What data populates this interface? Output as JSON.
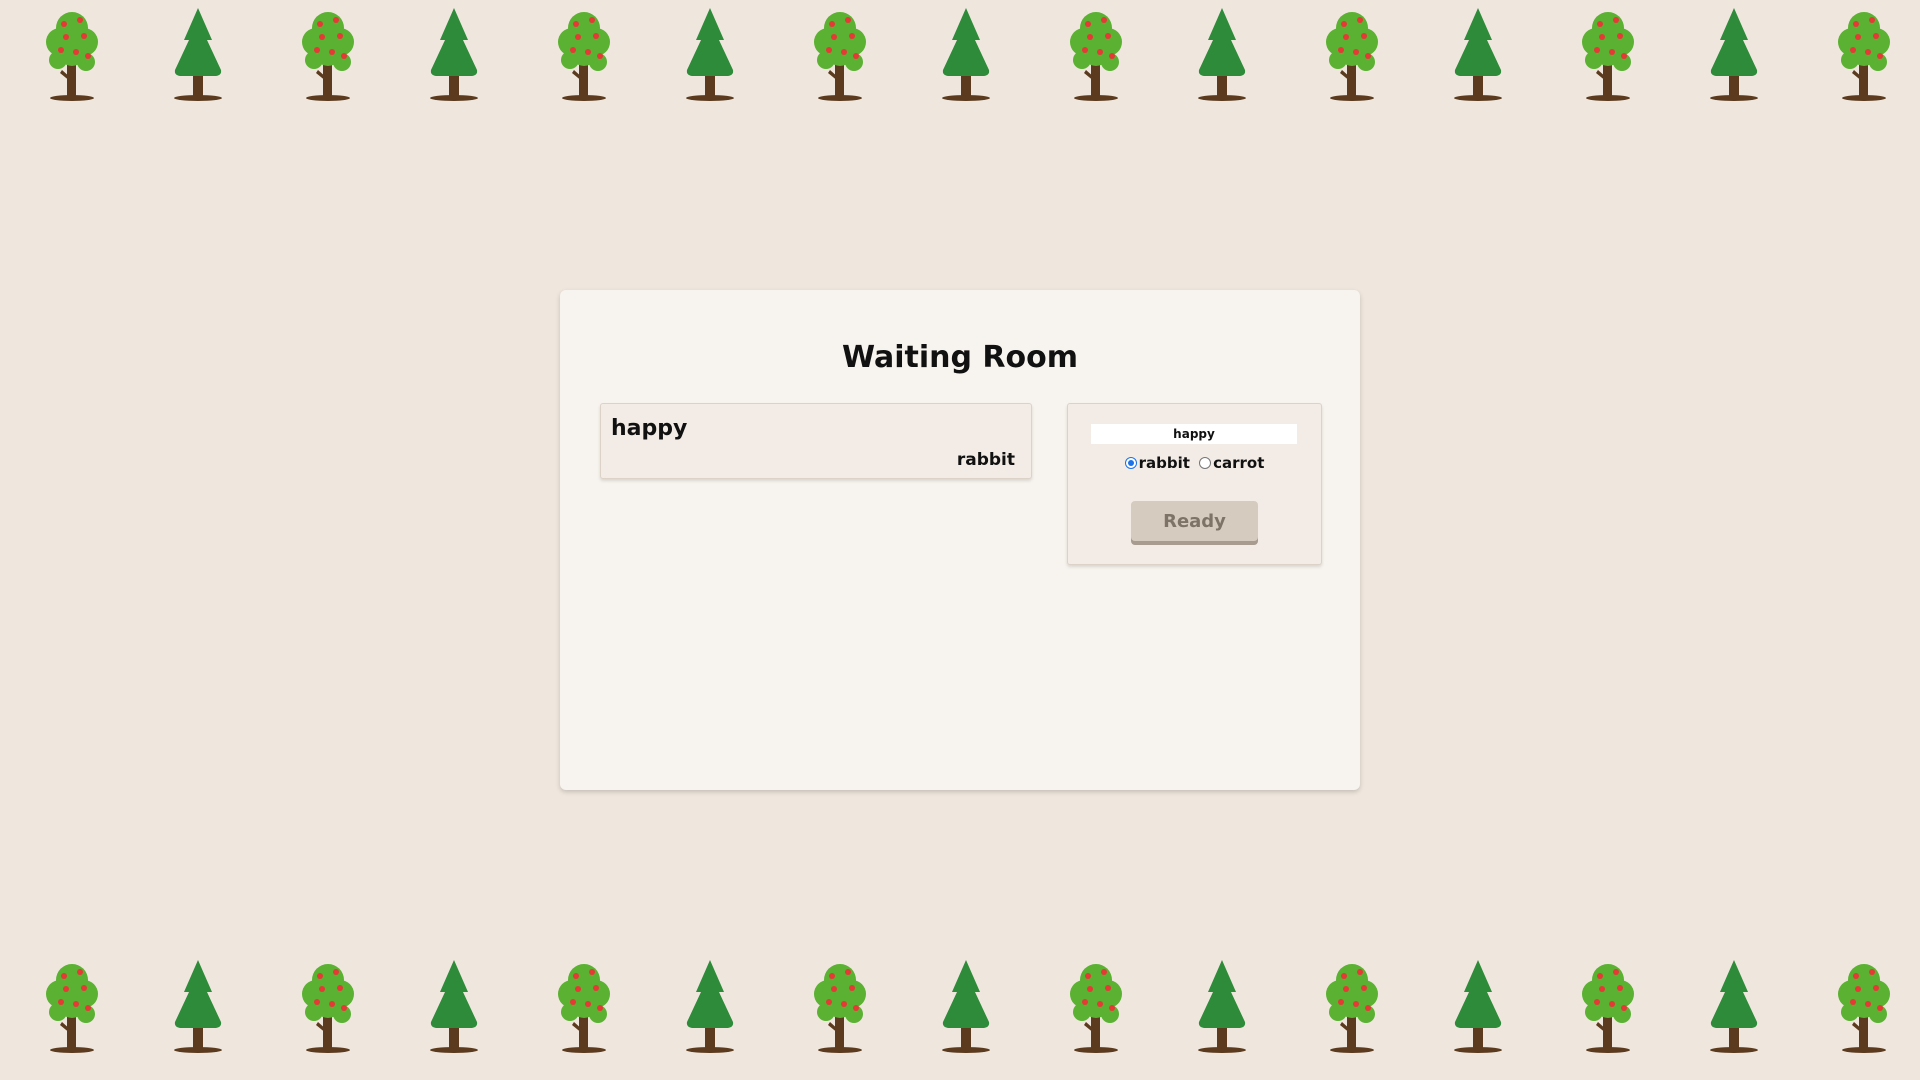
{
  "page": {
    "title": "Waiting Room"
  },
  "players": [
    {
      "name": "happy",
      "role": "rabbit"
    }
  ],
  "config": {
    "name_value": "happy",
    "roles": [
      {
        "label": "rabbit",
        "selected": true
      },
      {
        "label": "carrot",
        "selected": false
      }
    ],
    "ready_label": "Ready"
  },
  "decor": {
    "tree_pattern": [
      "apple-tree-icon",
      "pine-tree-icon"
    ],
    "colors": {
      "background": "#efe7dd",
      "card": "#f7f3ee",
      "apple_foliage": "#5ab132",
      "pine_foliage": "#2e8b3a",
      "apple_fruit": "#e53935",
      "trunk": "#5b3a1e",
      "button": "#d6cbbf"
    }
  }
}
